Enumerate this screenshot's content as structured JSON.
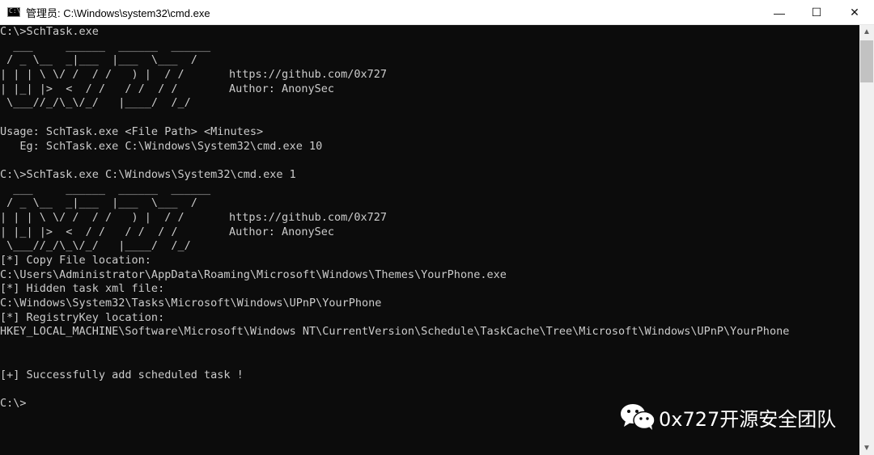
{
  "window": {
    "title": "管理员: C:\\Windows\\system32\\cmd.exe",
    "icon_label": "C:\\",
    "controls": {
      "minimize": "—",
      "maximize": "☐",
      "close": "✕"
    }
  },
  "console": {
    "block1": {
      "prompt": "C:\\>SchTask.exe",
      "banner_art": [
        "  ___     ______  ______  ______",
        " / _ \\__  _|___  |___  \\___  /",
        "| | | \\ \\/ /  / /   ) |  / /",
        "| |_| |>  <  / /   / /  / /",
        " \\___//_/\\_\\/_/   |____/  /_/"
      ],
      "link": "https://github.com/0x727",
      "author": "Author: AnonySec",
      "usage": "Usage: SchTask.exe <File Path> <Minutes>",
      "example": "   Eg: SchTask.exe C:\\Windows\\System32\\cmd.exe 10"
    },
    "block2": {
      "prompt": "C:\\>SchTask.exe C:\\Windows\\System32\\cmd.exe 1",
      "banner_art": [
        "  ___     ______  ______  ______",
        " / _ \\__  _|___  |___  \\___  /",
        "| | | \\ \\/ /  / /   ) |  / /",
        "| |_| |>  <  / /   / /  / /",
        " \\___//_/\\_\\/_/   |____/  /_/"
      ],
      "link": "https://github.com/0x727",
      "author": "Author: AnonySec"
    },
    "output": [
      "[*] Copy File location:",
      "C:\\Users\\Administrator\\AppData\\Roaming\\Microsoft\\Windows\\Themes\\YourPhone.exe",
      "[*] Hidden task xml file:",
      "C:\\Windows\\System32\\Tasks\\Microsoft\\Windows\\UPnP\\YourPhone",
      "[*] RegistryKey location:",
      "HKEY_LOCAL_MACHINE\\Software\\Microsoft\\Windows NT\\CurrentVersion\\Schedule\\TaskCache\\Tree\\Microsoft\\Windows\\UPnP\\YourPhone"
    ],
    "success": "[+] Successfully add scheduled task !",
    "final_prompt": "C:\\>"
  },
  "scrollbar": {
    "up": "▲",
    "down": "▼"
  },
  "watermark": {
    "text": "0x727开源安全团队",
    "icon": "wechat-icon"
  }
}
